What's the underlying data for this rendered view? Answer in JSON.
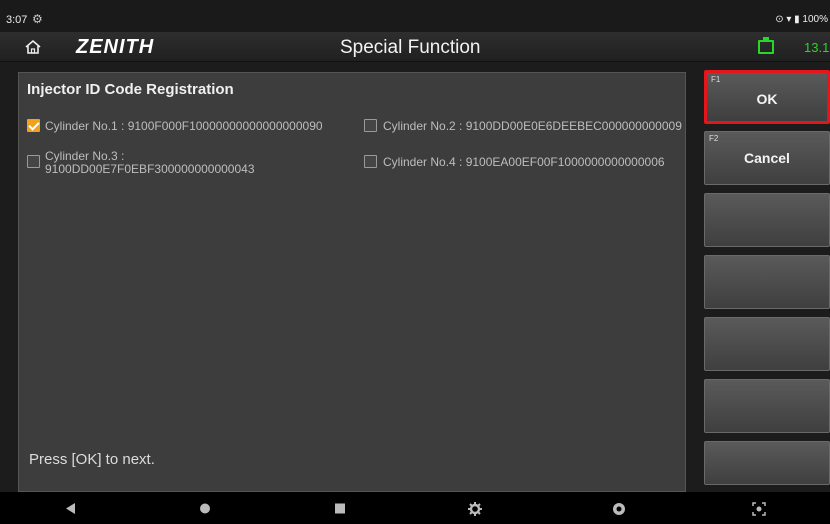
{
  "status_bar": {
    "time": "3:07",
    "settings_glyph": "⚙",
    "right_text": "⊙ ▾ ▮ 100%"
  },
  "header": {
    "logo": "ZENITH",
    "title": "Special Function",
    "battery_voltage": "13.1"
  },
  "panel": {
    "title": "Injector ID Code Registration",
    "cylinders": [
      {
        "label": "Cylinder No.1 : 9100F000F10000000000000000090",
        "checked": true
      },
      {
        "label": "Cylinder No.2 : 9100DD00E0E6DEEBEC000000000009",
        "checked": false
      },
      {
        "label_line1": "Cylinder No.3 :",
        "label_line2": "9100DD00E7F0EBF300000000000043",
        "checked": false
      },
      {
        "label": "Cylinder No.4 : 9100EA00EF00F1000000000000006",
        "checked": false
      }
    ],
    "footer": "Press [OK] to next."
  },
  "function_keys": [
    {
      "num": "F1",
      "label": "OK",
      "selected": true
    },
    {
      "num": "F2",
      "label": "Cancel",
      "selected": false
    },
    {
      "num": "",
      "label": "",
      "selected": false
    },
    {
      "num": "",
      "label": "",
      "selected": false
    },
    {
      "num": "",
      "label": "",
      "selected": false
    },
    {
      "num": "",
      "label": "",
      "selected": false
    },
    {
      "num": "",
      "label": "",
      "selected": false
    }
  ],
  "navbar": {
    "icons": [
      "back-icon",
      "home-icon",
      "recents-icon",
      "settings-icon",
      "browser-icon",
      "screenshot-icon"
    ]
  },
  "colors": {
    "accent_checkbox": "#f2a11a",
    "selected_border": "#e4161b",
    "battery": "#29d629"
  }
}
